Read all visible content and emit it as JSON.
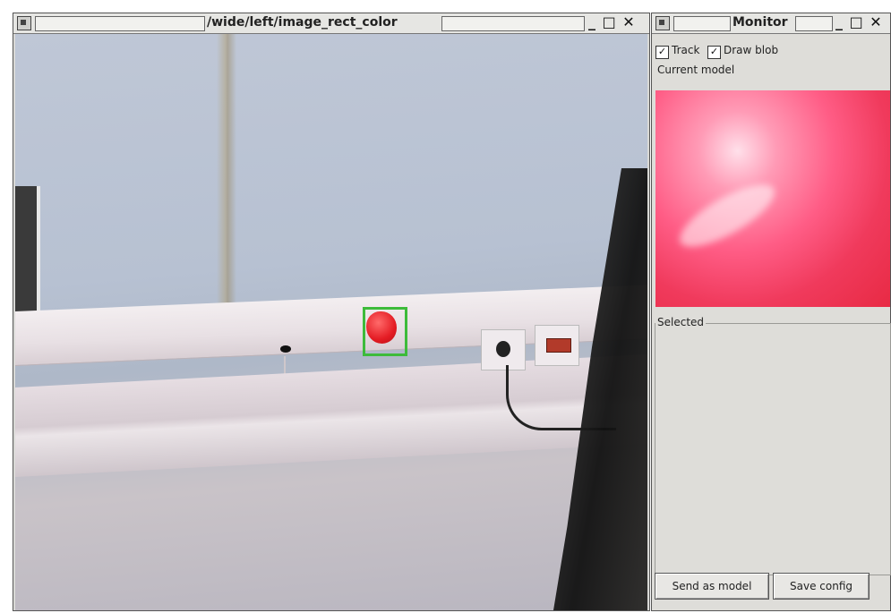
{
  "left_window": {
    "title": "/wide/left/image_rect_color",
    "controls": "_ □ ✕"
  },
  "right_window": {
    "title": "Monitor",
    "controls": "_ □ ✕",
    "track": {
      "label": "Track",
      "checked": true
    },
    "draw": {
      "label": "Draw blob",
      "checked": true
    },
    "current_model_label": "Current model",
    "selected_label": "Selected",
    "buttons": {
      "send": "Send as model",
      "save": "Save config"
    }
  }
}
